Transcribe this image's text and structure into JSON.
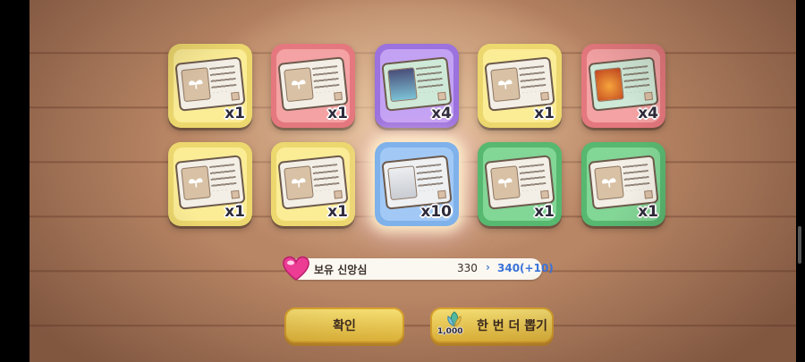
{
  "rewards": {
    "items": [
      {
        "qty": "x1",
        "icon": "sprout-ticket-icon"
      },
      {
        "qty": "x1",
        "icon": "sprout-ticket-icon"
      },
      {
        "qty": "x4",
        "icon": "character-ticket-icon"
      },
      {
        "qty": "x1",
        "icon": "sprout-ticket-icon"
      },
      {
        "qty": "x4",
        "icon": "character-ticket-icon"
      },
      {
        "qty": "x1",
        "icon": "sprout-ticket-icon"
      },
      {
        "qty": "x1",
        "icon": "sprout-ticket-icon"
      },
      {
        "qty": "x10",
        "icon": "character-ticket-icon"
      },
      {
        "qty": "x1",
        "icon": "sprout-ticket-icon"
      },
      {
        "qty": "x1",
        "icon": "sprout-ticket-icon"
      }
    ],
    "frame_colors": [
      "#fbed96",
      "#f4a2a4",
      "#c3a2f4",
      "#a2c9f6",
      "#82d696"
    ]
  },
  "faith": {
    "label": "보유 신앙심",
    "current": "330",
    "arrow": "›",
    "new": "340(+10)",
    "icon": "heart-gem-icon"
  },
  "buttons": {
    "confirm": "확인",
    "draw_again": "한 번 더 뽑기",
    "draw_cost": "1,000",
    "draw_icon": "leaf-gem-icon"
  }
}
